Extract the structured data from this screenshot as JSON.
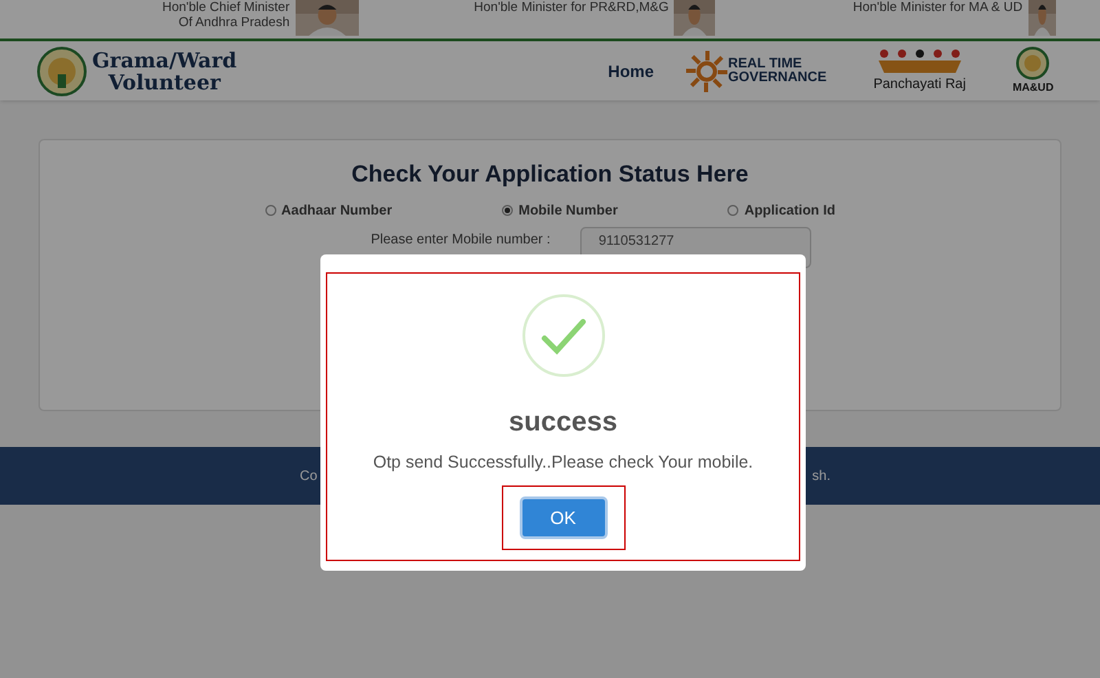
{
  "top_bar": {
    "ministers": [
      {
        "lines": [
          "Hon'ble Chief Minister",
          "Of Andhra Pradesh"
        ]
      },
      {
        "lines": [
          "Hon'ble Minister for PR&RD,M&G"
        ]
      },
      {
        "lines": [
          "Hon'ble Minister for MA & UD"
        ]
      }
    ]
  },
  "header": {
    "logo_lines": [
      "Grama/Ward",
      "Volunteer"
    ],
    "nav": "Home",
    "rtg_lines": [
      "REAL TIME",
      "GOVERNANCE"
    ],
    "panchayati": "Panchayati Raj",
    "maud": "MA&UD"
  },
  "form": {
    "title": "Check Your Application Status Here",
    "options": [
      {
        "label": "Aadhaar Number",
        "selected": false
      },
      {
        "label": "Mobile Number",
        "selected": true
      },
      {
        "label": "Application Id",
        "selected": false
      }
    ],
    "field_label": "Please enter Mobile number :",
    "value": "9110531277"
  },
  "footer": {
    "left": "Co",
    "right": "sh."
  },
  "dialog": {
    "title": "success",
    "message": "Otp send Successfully..Please check Your mobile.",
    "button": "OK"
  }
}
